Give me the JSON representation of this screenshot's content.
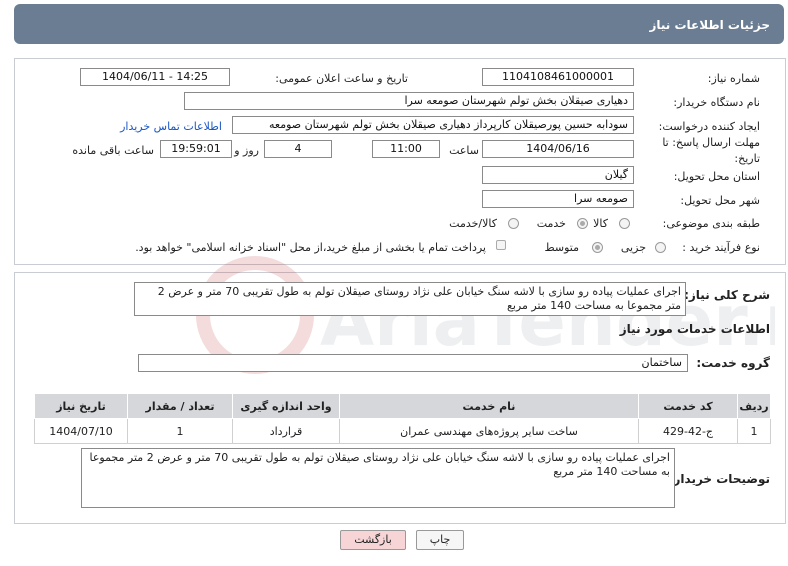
{
  "header": {
    "title": "جزئیات اطلاعات نیاز"
  },
  "form": {
    "need_number": {
      "label": "شماره نیاز:",
      "value": "1104108461000001"
    },
    "announce_datetime": {
      "label": "تاریخ و ساعت اعلان عمومی:",
      "value": "1404/06/11 - 14:25"
    },
    "buyer_org": {
      "label": "نام دستگاه خریدار:",
      "value": "دهیاری صیقلان بخش تولم شهرستان صومعه سرا"
    },
    "creator": {
      "label": "ایجاد کننده درخواست:",
      "value": "سودابه حسین پورصیقلان کارپرداز دهیاری صیقلان بخش تولم شهرستان صومعه",
      "link": "اطلاعات تماس خریدار"
    },
    "deadline": {
      "label_line1": "مهلت ارسال پاسخ: تا",
      "label_line2": "تاریخ:",
      "date": "1404/06/16",
      "time_label": "ساعت",
      "time": "11:00",
      "days": "4",
      "days_label": "روز و",
      "remaining": "19:59:01",
      "remaining_label": "ساعت باقی مانده"
    },
    "province": {
      "label": "استان محل تحویل:",
      "value": "گیلان"
    },
    "city": {
      "label": "شهر محل تحویل:",
      "value": "صومعه سرا"
    },
    "category": {
      "label": "طبقه بندی موضوعی:",
      "options": [
        "کالا",
        "خدمت",
        "کالا/خدمت"
      ],
      "selected": "خدمت"
    },
    "purchase_type": {
      "label": "نوع فرآیند خرید :",
      "options": [
        "جزیی",
        "متوسط"
      ],
      "selected": "متوسط",
      "payment_note": "پرداخت تمام یا بخشی از مبلغ خرید،از محل \"اسناد خزانه اسلامی\" خواهد بود."
    }
  },
  "summary": {
    "label": "شرح کلی نیاز:",
    "text": "اجرای عملیات پیاده رو سازی با لاشه سنگ خیابان علی نژاد روستای صیقلان تولم به طول تقریبی 70 متر و عرض 2 متر مجموعا به مساحت 140 متر مربع"
  },
  "services": {
    "section_title": "اطلاعات خدمات مورد نیاز",
    "group_label": "گروه خدمت:",
    "group_value": "ساختمان",
    "columns": [
      "ردیف",
      "کد خدمت",
      "نام خدمت",
      "واحد اندازه گیری",
      "تعداد / مقدار",
      "تاریخ نیاز"
    ],
    "rows": [
      [
        "1",
        "ج-42-429",
        "ساخت سایر پروژه‌های مهندسی عمران",
        "قرارداد",
        "1",
        "1404/07/10"
      ]
    ]
  },
  "buyer_notes": {
    "label": "توضیحات خریدار:",
    "text": "اجرای عملیات پیاده رو سازی با لاشه سنگ خیابان علی نژاد روستای صیقلان تولم به طول تقریبی 70 متر و عرض 2 متر مجموعا به مساحت 140 متر مربع"
  },
  "buttons": {
    "print": "چاپ",
    "back": "بازگشت"
  },
  "watermark": {
    "text": "AriaTender.net"
  },
  "colors": {
    "header_bg": "#6b7d93",
    "back_button_bg": "#f7d5d7",
    "link": "#1a56c4"
  }
}
